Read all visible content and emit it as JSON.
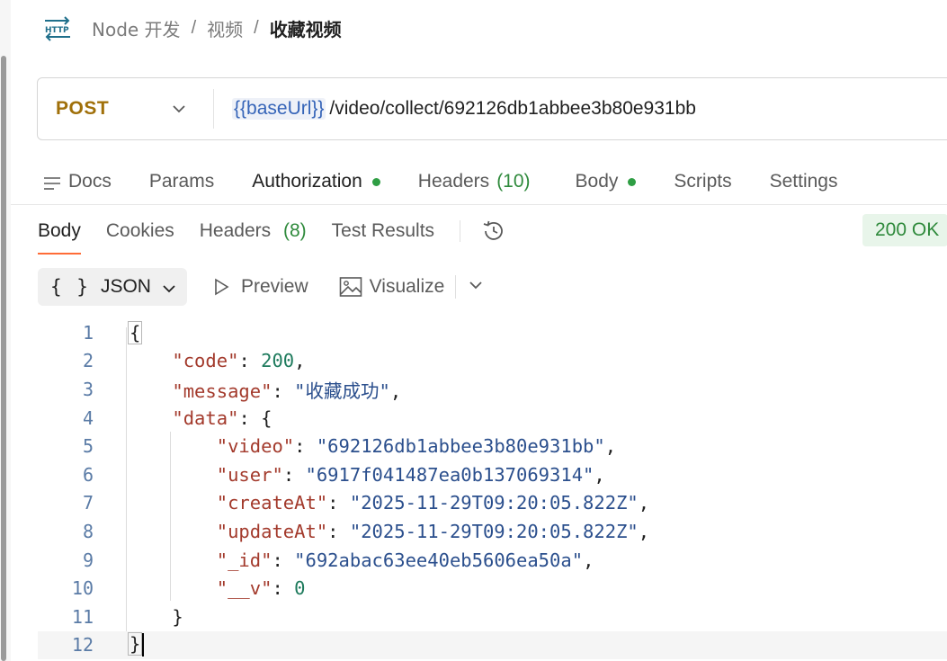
{
  "breadcrumb": {
    "icon": "http-icon",
    "items": [
      "Node 开发",
      "视频"
    ],
    "separator": "/",
    "current": "收藏视频"
  },
  "request": {
    "method": "POST",
    "url_variable": "{{baseUrl}}",
    "url_path": "/video/collect/692126db1abbee3b80e931bb",
    "method_color": "#a0700a"
  },
  "request_tabs": [
    {
      "label": "Docs"
    },
    {
      "label": "Params"
    },
    {
      "label": "Authorization"
    },
    {
      "label": "Headers",
      "count": "(10)"
    },
    {
      "label": "Body"
    },
    {
      "label": "Scripts"
    },
    {
      "label": "Settings"
    }
  ],
  "response_tabs": {
    "body": "Body",
    "cookies": "Cookies",
    "headers": "Headers",
    "headers_count": "(8)",
    "test_results": "Test Results"
  },
  "status": {
    "text": "200 OK",
    "color": "#2f8a3c"
  },
  "format_bar": {
    "json_braces": "{ }",
    "json_label": "JSON",
    "preview": "Preview",
    "visualize": "Visualize"
  },
  "code_lines": [
    {
      "n": "1"
    },
    {
      "n": "2"
    },
    {
      "n": "3"
    },
    {
      "n": "4"
    },
    {
      "n": "5"
    },
    {
      "n": "6"
    },
    {
      "n": "7"
    },
    {
      "n": "8"
    },
    {
      "n": "9"
    },
    {
      "n": "10"
    },
    {
      "n": "11"
    },
    {
      "n": "12"
    }
  ],
  "response_json": {
    "code_key": "\"code\"",
    "code_value": "200",
    "message_key": "\"message\"",
    "message_value": "\"收藏成功\"",
    "data_key": "\"data\"",
    "video_key": "\"video\"",
    "video_value": "\"692126db1abbee3b80e931bb\"",
    "user_key": "\"user\"",
    "user_value": "\"6917f041487ea0b137069314\"",
    "createAt_key": "\"createAt\"",
    "createAt_value": "\"2025-11-29T09:20:05.822Z\"",
    "updateAt_key": "\"updateAt\"",
    "updateAt_value": "\"2025-11-29T09:20:05.822Z\"",
    "id_key": "\"_id\"",
    "id_value": "\"692abac63ee40eb5606ea50a\"",
    "v_key": "\"__v\"",
    "v_value": "0"
  },
  "syntax_colors": {
    "key": "#a33a2c",
    "string": "#2b4f8d",
    "number": "#1d7a5c"
  }
}
